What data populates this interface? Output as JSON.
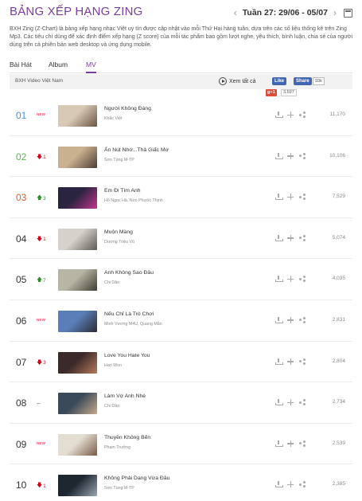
{
  "header": {
    "title": "BẢNG XẾP HẠNG ZING",
    "week_label": "Tuần 27: 29/06 - 05/07",
    "prev_arrow": "‹",
    "next_arrow": "›"
  },
  "description": "BXH Zing (Z-Chart) là bảng xếp hạng nhạc Việt uy tín được cập nhật vào mỗi Thứ Hai hàng tuần, dựa trên các số liệu thống kê trên Zing Mp3. Các tiêu chí dùng để xác định điểm xếp hạng (Z score) của mỗi tác phẩm bao gồm lượt nghe, yêu thích, bình luận, chia sẻ của người dùng trên cả phiên bản web desktop và ứng dụng mobile.",
  "tabs": [
    {
      "label": "Bài Hát",
      "active": false
    },
    {
      "label": "Album",
      "active": false
    },
    {
      "label": "MV",
      "active": true
    }
  ],
  "subbar": {
    "title": "BXH Video Việt Nam",
    "view_all": "Xem tất cả",
    "fb_like": "Like",
    "fb_share": "Share",
    "fb_count": "93k",
    "gplus": "g+1",
    "gplus_count": "3.597"
  },
  "icons": {
    "download": "download-icon",
    "add": "add-icon",
    "share": "share-icon",
    "calendar": "calendar-icon",
    "play": "play-icon"
  },
  "colors": {
    "accent": "#7a3ea0",
    "rank1": "#4a90e2",
    "rank2": "#50b848",
    "rank3": "#e35b2a",
    "new": "#ff4a6b",
    "up": "#2e8b2e",
    "down": "#d0021b"
  },
  "new_badge": "NEW",
  "rows": [
    {
      "rank": "01",
      "change": "new",
      "change_value": "",
      "title": "Người Không Đáng",
      "artist": "Khắc Việt",
      "score": "11,170",
      "thumb": [
        "#d8c9b5",
        "#6b5442"
      ]
    },
    {
      "rank": "02",
      "change": "down",
      "change_value": "1",
      "title": "Ấn Nút Nhớ...Thả Giấc Mơ",
      "artist": "Sơn Tùng M-TP",
      "score": "10,106",
      "thumb": [
        "#c9b08f",
        "#4d3c33"
      ]
    },
    {
      "rank": "03",
      "change": "up",
      "change_value": "3",
      "title": "Em Đi Tìm Anh",
      "artist": "Hồ Ngọc Hà, Noo Phước Thịnh",
      "score": "7,529",
      "thumb": [
        "#2a2440",
        "#c2358e"
      ]
    },
    {
      "rank": "04",
      "change": "down",
      "change_value": "1",
      "title": "Muộn Màng",
      "artist": "Dương Triệu Vũ",
      "score": "5,074",
      "thumb": [
        "#d5d2cc",
        "#5d5a55"
      ]
    },
    {
      "rank": "05",
      "change": "up",
      "change_value": "7",
      "title": "Anh Không Sao Đâu",
      "artist": "Chi Dân",
      "score": "4,035",
      "thumb": [
        "#b7b6a5",
        "#3d3c30"
      ]
    },
    {
      "rank": "06",
      "change": "new",
      "change_value": "",
      "title": "Nếu Chỉ Là Trò Chơi",
      "artist": "Minh Vương M4U, Quang Mẫn",
      "score": "2,831",
      "thumb": [
        "#5a7fb8",
        "#2b2b35"
      ]
    },
    {
      "rank": "07",
      "change": "down",
      "change_value": "3",
      "title": "Love You Hate You",
      "artist": "Hari Won",
      "score": "2,804",
      "thumb": [
        "#3b2a2a",
        "#b77a5a"
      ]
    },
    {
      "rank": "08",
      "change": "same",
      "change_value": "–",
      "title": "Làm Vợ Anh Nhé",
      "artist": "Chi Dân",
      "score": "2,734",
      "thumb": [
        "#3a4a5a",
        "#c7a98a"
      ]
    },
    {
      "rank": "09",
      "change": "new",
      "change_value": "",
      "title": "Thuyền Không Bến",
      "artist": "Phạm Trưởng",
      "score": "2,539",
      "thumb": [
        "#e4ddd2",
        "#7a5a45"
      ]
    },
    {
      "rank": "10",
      "change": "down",
      "change_value": "1",
      "title": "Không Phải Dạng Vừa Đâu",
      "artist": "Sơn Tùng M-TP",
      "score": "2,385",
      "thumb": [
        "#1e2630",
        "#9aa6b0"
      ]
    }
  ]
}
